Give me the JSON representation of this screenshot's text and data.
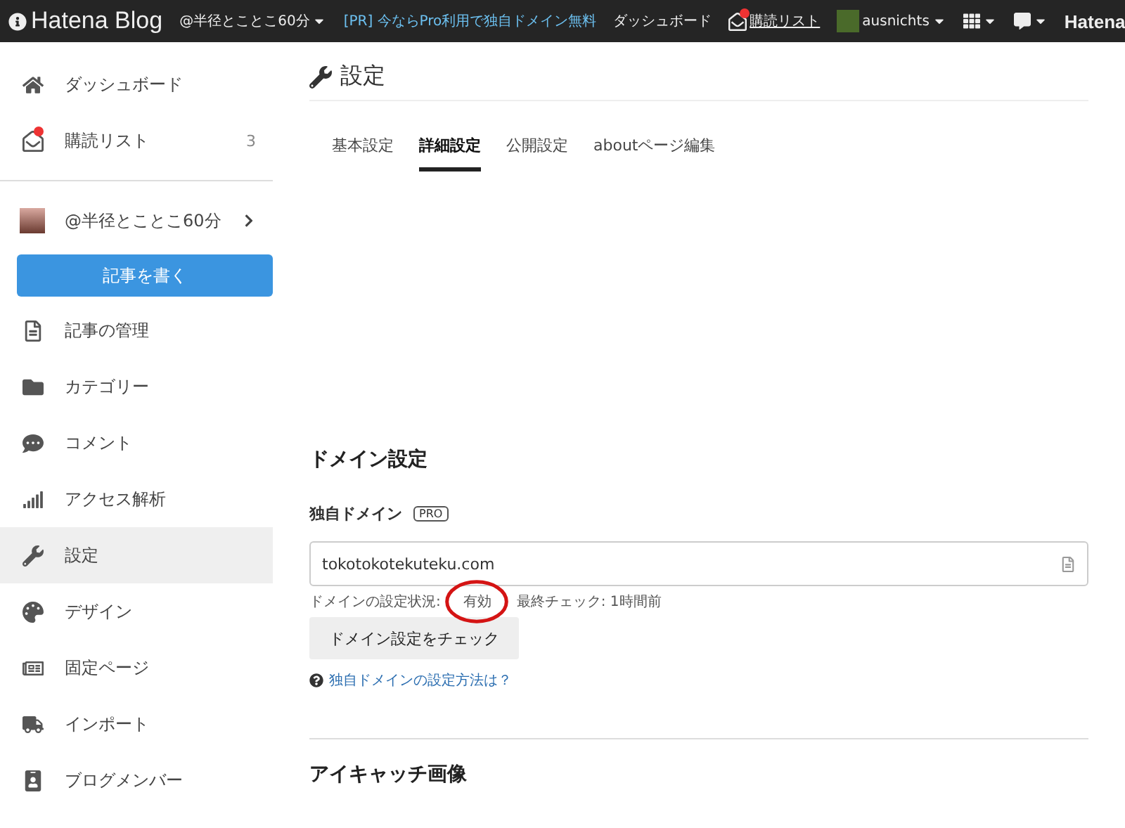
{
  "topbar": {
    "logo": "Hatena Blog",
    "blog_menu": "@半径とことこ60分",
    "promo": "[PR] 今ならPro利用で独自ドメイン無料",
    "dashboard": "ダッシュボード",
    "reading_list": {
      "label": "購読リスト",
      "unread": true
    },
    "user": "ausnichts",
    "brand": "Hatena"
  },
  "sidebar": {
    "top_items": [
      {
        "label": "ダッシュボード",
        "unread": false
      },
      {
        "label": "購読リスト",
        "count": "3",
        "unread": true
      }
    ],
    "blog": "@半径とことこ60分",
    "write_button": "記事を書く",
    "items": [
      {
        "label": "記事の管理",
        "selected": false
      },
      {
        "label": "カテゴリー",
        "selected": false
      },
      {
        "label": "コメント",
        "selected": false
      },
      {
        "label": "アクセス解析",
        "selected": false
      },
      {
        "label": "設定",
        "selected": true
      },
      {
        "label": "デザイン",
        "selected": false
      },
      {
        "label": "固定ページ",
        "selected": false
      },
      {
        "label": "インポート",
        "selected": false
      },
      {
        "label": "ブログメンバー",
        "selected": false
      }
    ]
  },
  "page": {
    "title": "設定",
    "tabs": [
      {
        "label": "基本設定",
        "selected": false
      },
      {
        "label": "詳細設定",
        "selected": true
      },
      {
        "label": "公開設定",
        "selected": false
      },
      {
        "label": "aboutページ編集",
        "selected": false
      }
    ],
    "domain": {
      "heading": "ドメイン設定",
      "label": "独自ドメイン",
      "badge": "PRO",
      "value": "tokotokotekuteku.com",
      "status_label": "ドメインの設定状況:",
      "status": "有効",
      "last_check": "最終チェック: 1時間前",
      "check_button": "ドメイン設定をチェック",
      "help_link": "独自ドメインの設定方法は？",
      "status_circled": true
    },
    "next_heading": "アイキャッチ画像"
  }
}
